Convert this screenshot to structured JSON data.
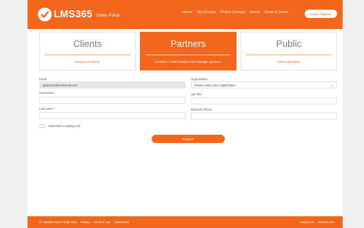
{
  "header": {
    "brand": "LMS365",
    "brand_sub": "Demo Portal",
    "nav": [
      "Home",
      "My Groups",
      "Public Groups",
      "About",
      "Book a Demo"
    ],
    "login_label": "Login / Register"
  },
  "cards": [
    {
      "title": "Clients",
      "description": "Envision IT clients."
    },
    {
      "title": "Partners",
      "description": "Envision IT and Extranet User Manager partners."
    },
    {
      "title": "Public",
      "description": "Other individuals."
    }
  ],
  "form": {
    "email_label": "Email",
    "email_value": "tguest123@envisionit.com",
    "first_name_label": "First Name *",
    "first_name_value": "",
    "last_name_label": "Last name *",
    "last_name_value": "",
    "organization_label": "Organization",
    "organization_value": "Please select your organization",
    "job_title_label": "Job Title",
    "job_title_value": "",
    "business_phone_label": "Business Phone",
    "business_phone_value": "",
    "subscribe_label": "Subscribe to Mailing List",
    "subscribe_checked": false,
    "register_label": "Register"
  },
  "footer": {
    "links_left": [
      "© LMS365 Demo Portal 2023",
      "Privacy",
      "Terms of Use",
      "Trademarks"
    ],
    "links_right": [
      "Contact Us",
      "LMS365.com"
    ]
  },
  "colors": {
    "accent": "#f4661b",
    "background": "#f0f0f0"
  }
}
